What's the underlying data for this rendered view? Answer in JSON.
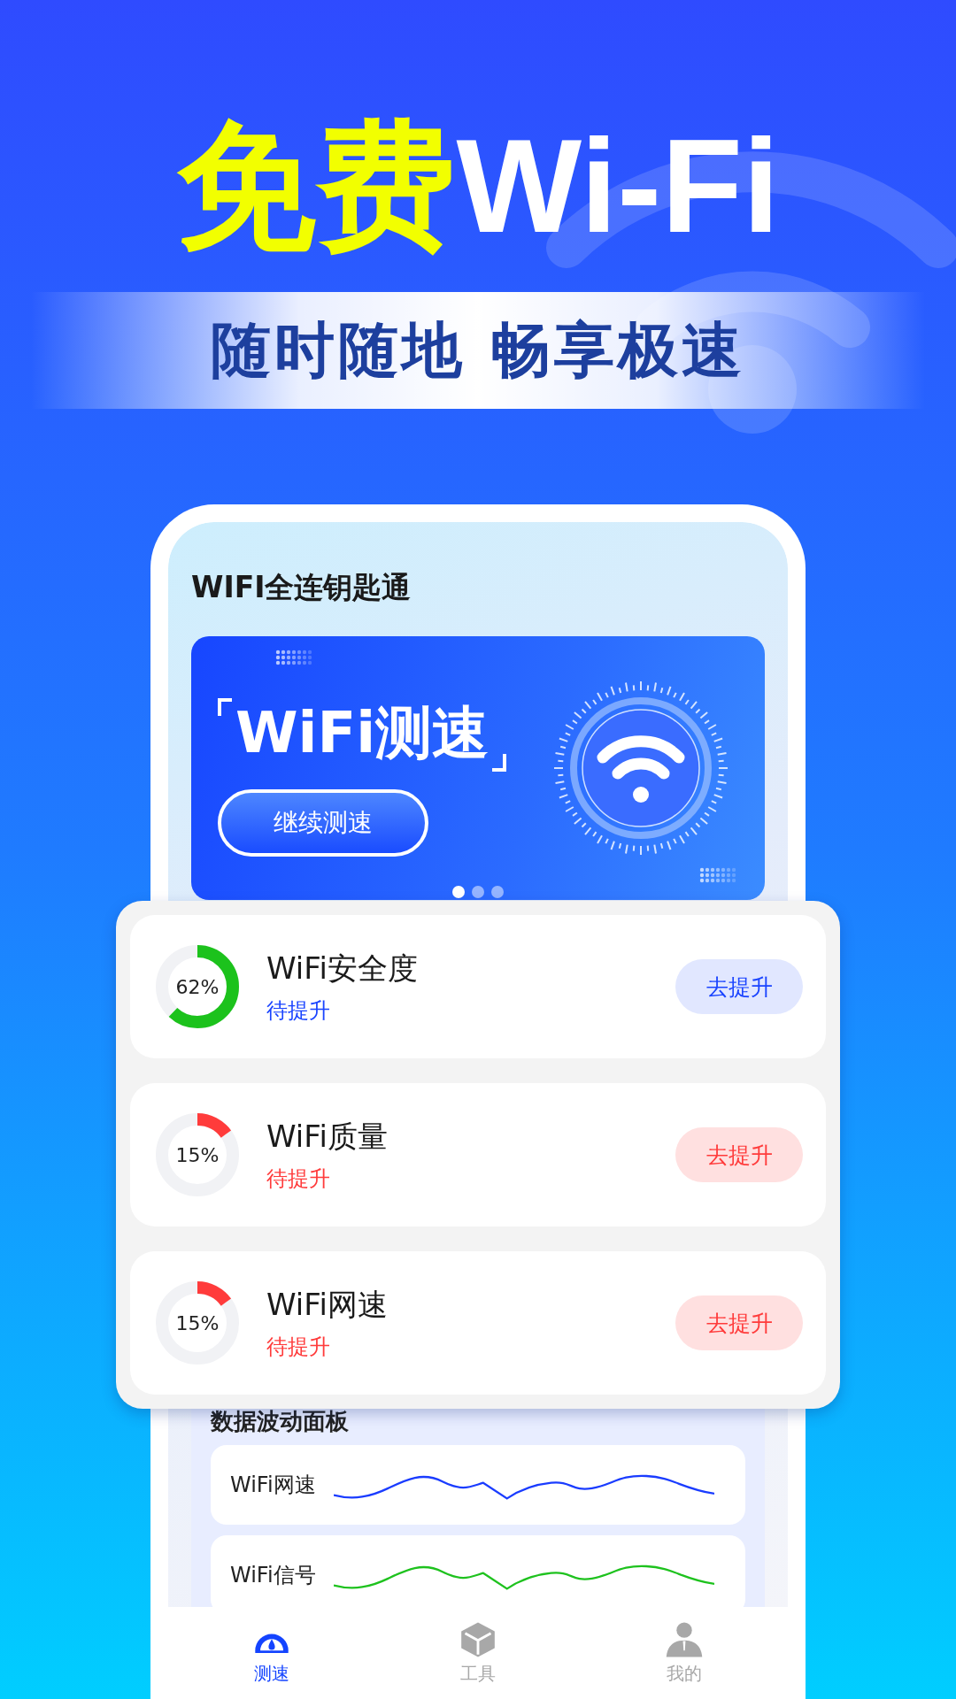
{
  "headline": {
    "highlight": "免费",
    "rest": "Wi-Fi"
  },
  "tagline": "随时随地 畅享极速",
  "app": {
    "title": "WIFI全连钥匙通",
    "banner": {
      "title": "WiFi测速",
      "button": "继续测速",
      "pages": [
        {
          "selected": true
        },
        {
          "selected": false
        },
        {
          "selected": false
        }
      ]
    },
    "metrics": [
      {
        "name": "WiFi安全度",
        "reading": "62%",
        "level": 0.62,
        "color": "#1cc21c",
        "status": "待提升",
        "kind": "info",
        "button": "去提升"
      },
      {
        "name": "WiFi质量",
        "reading": "15%",
        "level": 0.15,
        "color": "#ff3b3b",
        "status": "待提升",
        "kind": "alert",
        "button": "去提升"
      },
      {
        "name": "WiFi网速",
        "reading": "15%",
        "level": 0.15,
        "color": "#ff3b3b",
        "status": "待提升",
        "kind": "alert",
        "button": "去提升"
      }
    ],
    "panel": {
      "title": "数据波动面板",
      "rows": [
        {
          "label": "WiFi网速",
          "color": "#1a3cff"
        },
        {
          "label": "WiFi信号",
          "color": "#1ec21e"
        }
      ]
    },
    "nav": [
      {
        "label": "测速",
        "selected": true
      },
      {
        "label": "工具",
        "selected": false
      },
      {
        "label": "我的",
        "selected": false
      }
    ]
  }
}
